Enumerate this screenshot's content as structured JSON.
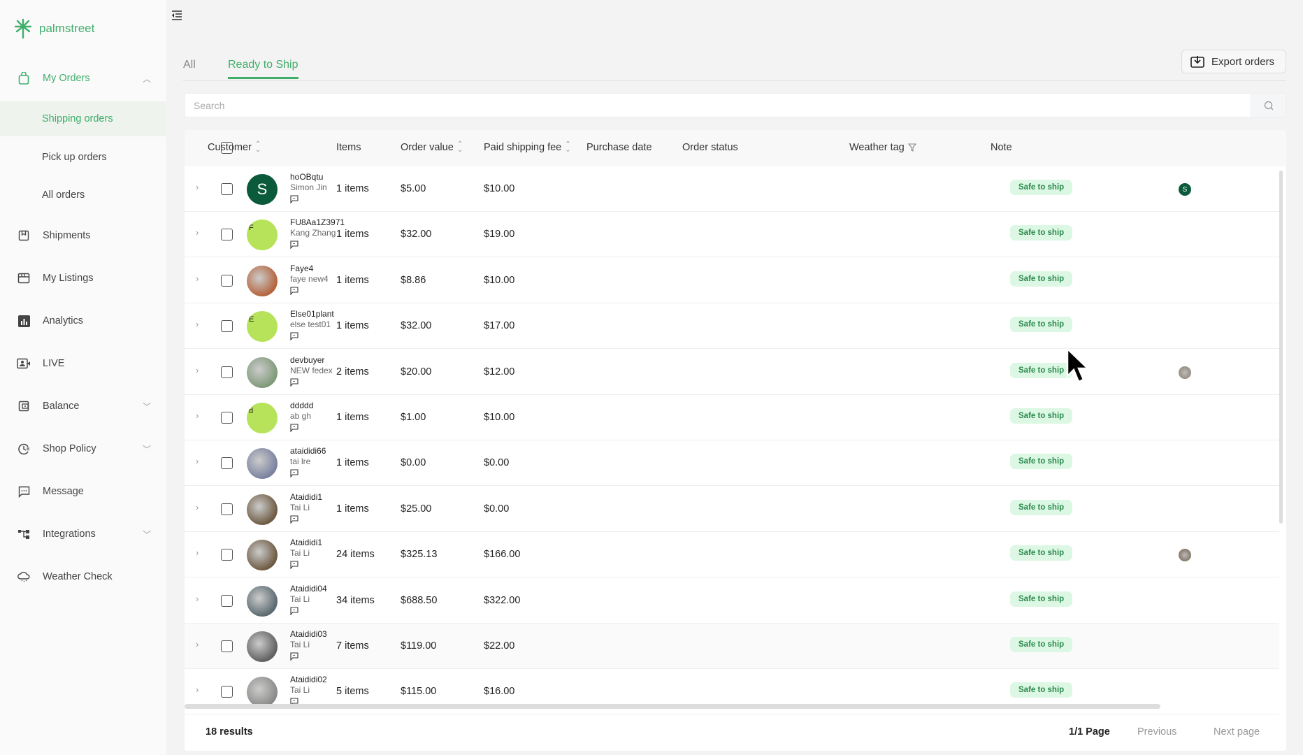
{
  "brand": {
    "name": "palmstreet",
    "color": "#3fae6a"
  },
  "sidebar": {
    "items": [
      {
        "label": "My Orders",
        "icon": "shopping-bag-icon",
        "expanded": true
      },
      {
        "label": "Shipping orders",
        "sub": true,
        "active": true
      },
      {
        "label": "Pick up orders",
        "sub": true
      },
      {
        "label": "All orders",
        "sub": true
      },
      {
        "label": "Shipments",
        "icon": "package-icon"
      },
      {
        "label": "My Listings",
        "icon": "storefront-icon"
      },
      {
        "label": "Analytics",
        "icon": "bar-chart-icon"
      },
      {
        "label": "LIVE",
        "icon": "video-icon"
      },
      {
        "label": "Balance",
        "icon": "wallet-icon",
        "chevron": true
      },
      {
        "label": "Shop Policy",
        "icon": "clock-policy-icon",
        "chevron": true
      },
      {
        "label": "Message",
        "icon": "message-icon"
      },
      {
        "label": "Integrations",
        "icon": "integrations-icon",
        "chevron": true
      },
      {
        "label": "Weather Check",
        "icon": "cloud-icon"
      }
    ]
  },
  "tabs": [
    {
      "label": "All"
    },
    {
      "label": "Ready to Ship",
      "active": true
    }
  ],
  "toolbar": {
    "export_label": "Export orders"
  },
  "search": {
    "placeholder": "Search",
    "value": ""
  },
  "table": {
    "headers": {
      "customer": "Customer",
      "items": "Items",
      "order_value": "Order value",
      "shipping": "Paid shipping fee",
      "purchase_date": "Purchase date",
      "status": "Order status",
      "weather": "Weather tag",
      "note": "Note"
    },
    "rows": [
      {
        "username": "hoOBqtu",
        "name": "Simon Jin",
        "items": "1 items",
        "value": "$5.00",
        "shipping": "$10.00",
        "weather": "Safe to ship",
        "avatar": "S",
        "avatar_color": "#0b5a3c",
        "note": "S",
        "note_color": "#0b5a3c"
      },
      {
        "username": "FU8Aa1Z3971",
        "name": "Kang Zhang",
        "items": "1 items",
        "value": "$32.00",
        "shipping": "$19.00",
        "weather": "Safe to ship",
        "avatar": "F",
        "avatar_color": "lime"
      },
      {
        "username": "Faye4",
        "name": "faye new4",
        "items": "1 items",
        "value": "$8.86",
        "shipping": "$10.00",
        "weather": "Safe to ship",
        "avatar_color": "#b4643c"
      },
      {
        "username": "Else01plant",
        "name": "else test01",
        "items": "1 items",
        "value": "$32.00",
        "shipping": "$17.00",
        "weather": "Safe to ship",
        "avatar": "E",
        "avatar_color": "lime"
      },
      {
        "username": "devbuyer",
        "name": "NEW fedex",
        "items": "2 items",
        "value": "$20.00",
        "shipping": "$12.00",
        "weather": "Safe to ship",
        "avatar_color": "#7f9a78",
        "note_color": "#8a7a6a"
      },
      {
        "username": "ddddd",
        "name": "ab gh",
        "items": "1 items",
        "value": "$1.00",
        "shipping": "$10.00",
        "weather": "Safe to ship",
        "avatar": "d",
        "avatar_color": "lime"
      },
      {
        "username": "ataididi66",
        "name": "tai lre",
        "items": "1 items",
        "value": "$0.00",
        "shipping": "$0.00",
        "weather": "Safe to ship",
        "avatar_color": "#7a82a0"
      },
      {
        "username": "Ataididi1",
        "name": "Tai Li",
        "items": "1 items",
        "value": "$25.00",
        "shipping": "$0.00",
        "weather": "Safe to ship",
        "avatar_color": "#6e5a42"
      },
      {
        "username": "Ataididi1",
        "name": "Tai Li",
        "items": "24 items",
        "value": "$325.13",
        "shipping": "$166.00",
        "weather": "Safe to ship",
        "avatar_color": "#6e5a42",
        "note_color": "#6e5a42"
      },
      {
        "username": "Ataididi04",
        "name": "Tai Li",
        "items": "34 items",
        "value": "$688.50",
        "shipping": "$322.00",
        "weather": "Safe to ship",
        "avatar_color": "#5a6a70"
      },
      {
        "username": "Ataididi03",
        "name": "Tai Li",
        "items": "7 items",
        "value": "$119.00",
        "shipping": "$22.00",
        "weather": "Safe to ship",
        "avatar_color": "#606060"
      },
      {
        "username": "Ataididi02",
        "name": "Tai Li",
        "items": "5 items",
        "value": "$115.00",
        "shipping": "$16.00",
        "weather": "Safe to ship",
        "avatar_color": "#8a8a88"
      }
    ]
  },
  "footer": {
    "results": "18 results",
    "page": "1/1 Page",
    "previous": "Previous",
    "next": "Next page"
  }
}
